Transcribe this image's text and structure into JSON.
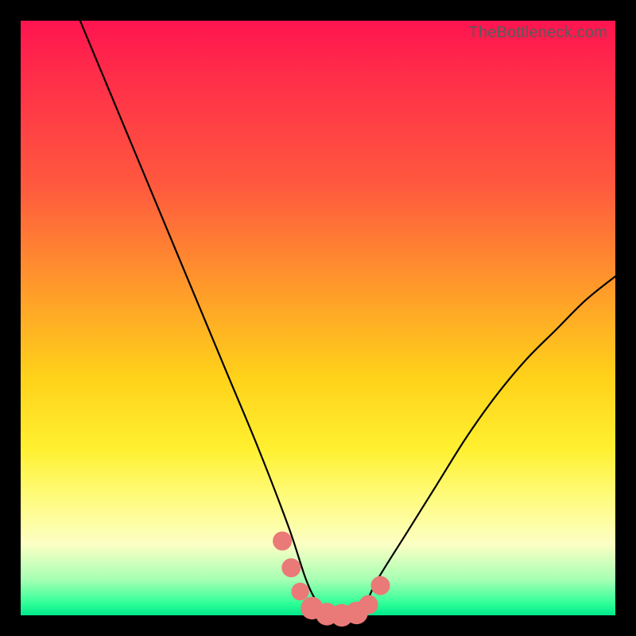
{
  "watermark": "TheBottleneck.com",
  "chart_data": {
    "type": "line",
    "title": "",
    "xlabel": "",
    "ylabel": "",
    "xlim": [
      0,
      100
    ],
    "ylim": [
      0,
      100
    ],
    "series": [
      {
        "name": "bottleneck-curve",
        "x": [
          10,
          15,
          20,
          25,
          30,
          35,
          40,
          45,
          48,
          50,
          52,
          54,
          56,
          58,
          60,
          65,
          70,
          75,
          80,
          85,
          90,
          95,
          100
        ],
        "y": [
          100,
          88,
          76,
          64,
          52,
          40,
          28,
          15,
          6,
          2,
          0,
          0,
          0,
          2,
          6,
          14,
          22,
          30,
          37,
          43,
          48,
          53,
          57
        ]
      }
    ],
    "markers": [
      {
        "x": 44.0,
        "y": 12.5,
        "r": 1.6
      },
      {
        "x": 45.5,
        "y": 8.0,
        "r": 1.6
      },
      {
        "x": 47.0,
        "y": 4.0,
        "r": 1.4
      },
      {
        "x": 49.0,
        "y": 1.2,
        "r": 2.2
      },
      {
        "x": 51.5,
        "y": 0.2,
        "r": 2.2
      },
      {
        "x": 54.0,
        "y": 0.0,
        "r": 2.2
      },
      {
        "x": 56.5,
        "y": 0.4,
        "r": 2.2
      },
      {
        "x": 58.5,
        "y": 1.8,
        "r": 1.6
      },
      {
        "x": 60.5,
        "y": 5.0,
        "r": 1.6
      }
    ],
    "gradient_stops": [
      {
        "pos": 0.0,
        "color": "#ff1450"
      },
      {
        "pos": 0.28,
        "color": "#ff5a3e"
      },
      {
        "pos": 0.6,
        "color": "#ffd21a"
      },
      {
        "pos": 0.88,
        "color": "#fcffc4"
      },
      {
        "pos": 1.0,
        "color": "#00e88a"
      }
    ],
    "marker_color": "#e97a77",
    "curve_color": "#000000"
  }
}
